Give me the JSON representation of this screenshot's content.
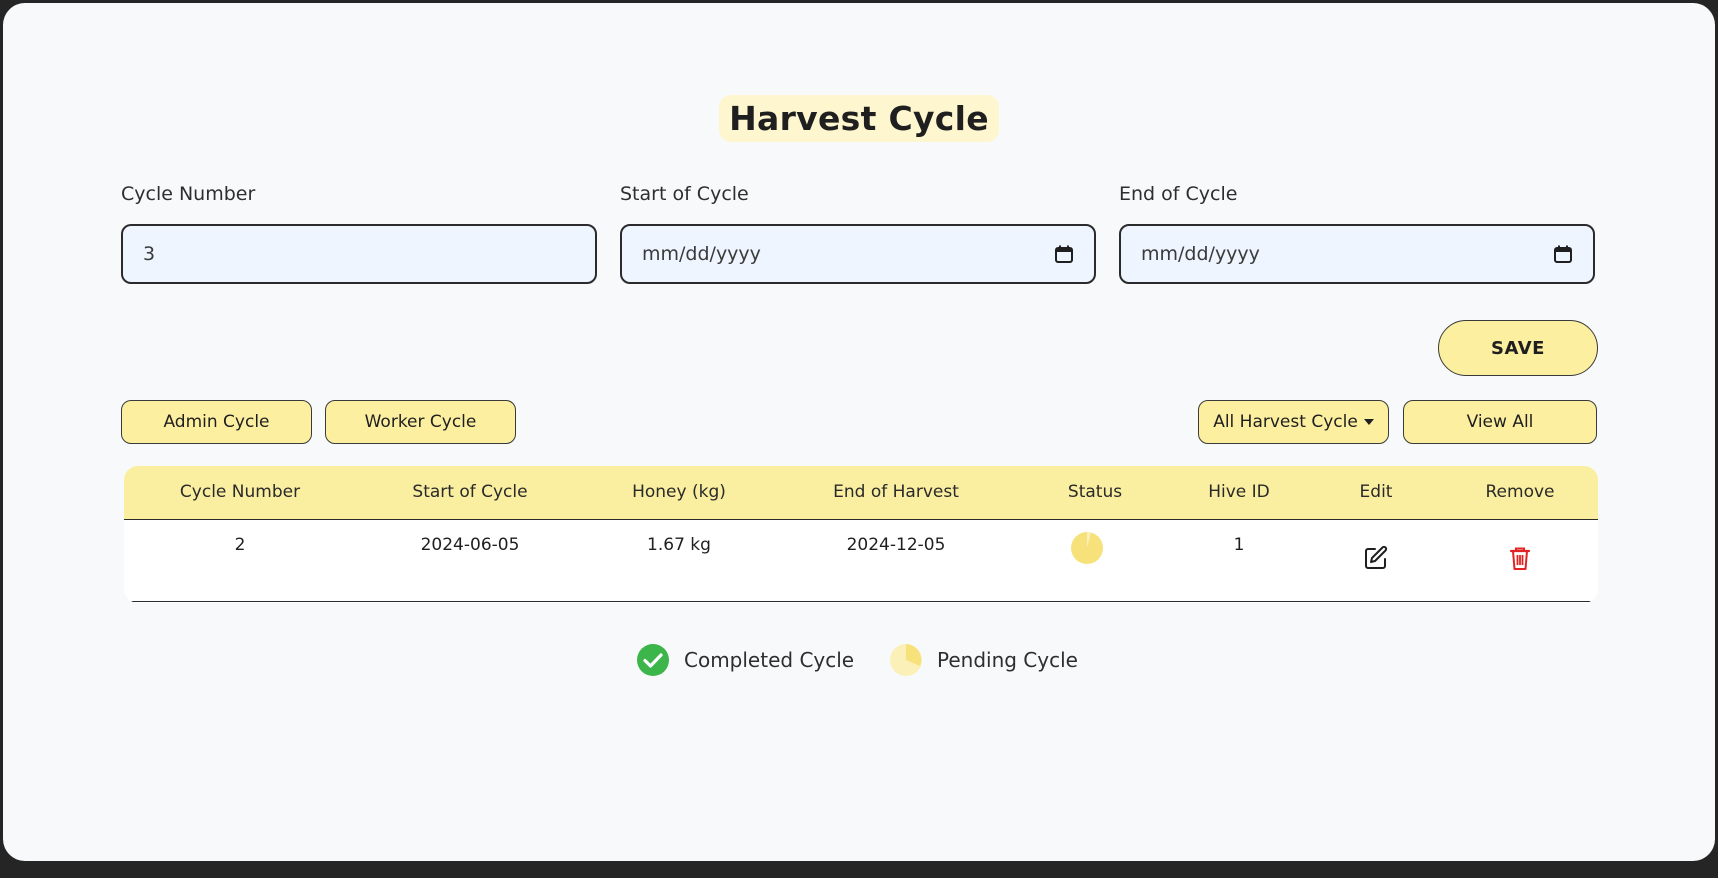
{
  "page": {
    "title": "Harvest Cycle"
  },
  "form": {
    "cycle_number": {
      "label": "Cycle Number",
      "value": "3"
    },
    "start_of_cycle": {
      "label": "Start of Cycle",
      "placeholder": "mm/dd/yyyy"
    },
    "end_of_cycle": {
      "label": "End of Cycle",
      "placeholder": "mm/dd/yyyy"
    },
    "save_label": "SAVE"
  },
  "filters": {
    "admin_cycle": "Admin Cycle",
    "worker_cycle": "Worker Cycle",
    "all_harvest_cycle": "All Harvest Cycle",
    "view_all": "View All"
  },
  "table": {
    "headers": [
      "Cycle Number",
      "Start of Cycle",
      "Honey (kg)",
      "End of Harvest",
      "Status",
      "Hive ID",
      "Edit",
      "Remove"
    ],
    "rows": [
      {
        "cycle_number": "2",
        "start_of_cycle": "2024-06-05",
        "honey": "1.67 kg",
        "end_of_harvest": "2024-12-05",
        "status": "pending",
        "hive_id": "1"
      }
    ]
  },
  "legend": {
    "completed": "Completed Cycle",
    "pending": "Pending Cycle"
  },
  "colors": {
    "accent_yellow": "#fcefa0",
    "completed_green": "#3cb54a",
    "pending_yellow": "#f7e17a",
    "remove_red": "#e02424"
  },
  "icons": {
    "edit": "edit-icon",
    "remove": "trash-icon",
    "calendar": "calendar-icon"
  }
}
